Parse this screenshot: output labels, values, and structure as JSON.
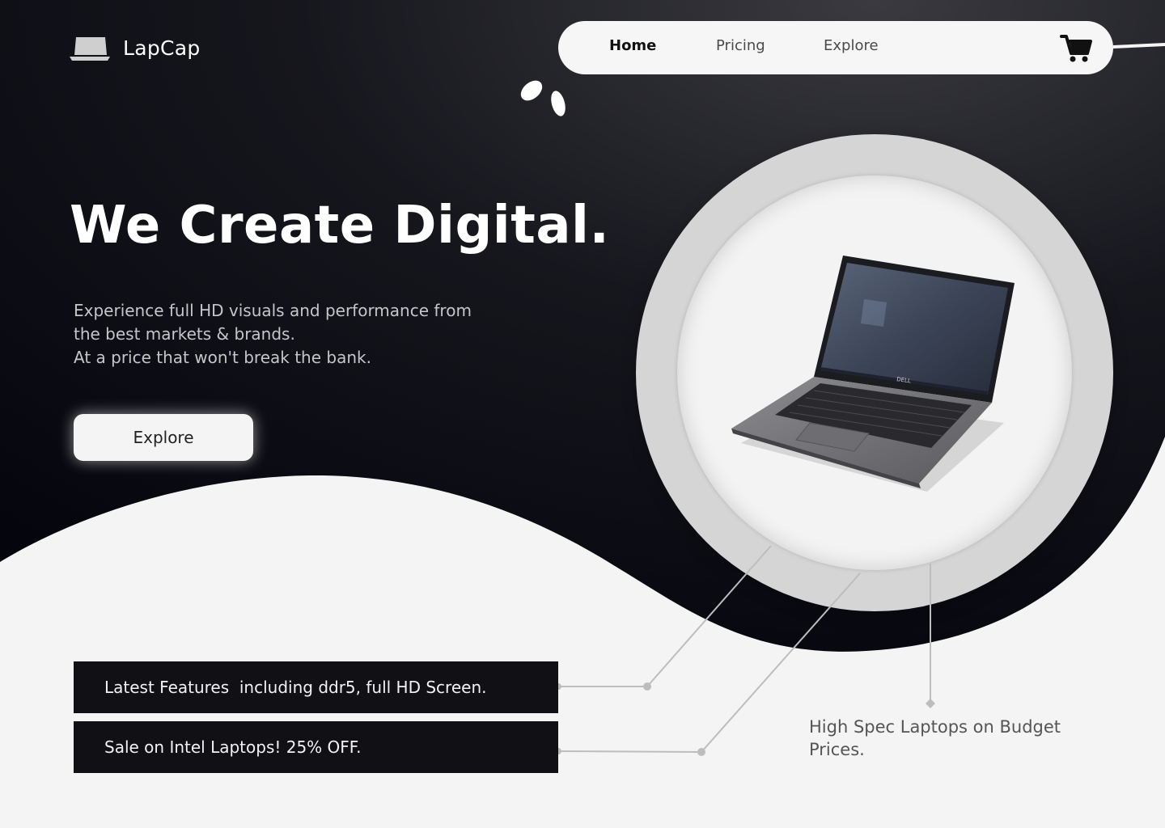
{
  "brand": {
    "name": "LapCap",
    "logo_icon": "laptop-icon"
  },
  "nav": {
    "items": [
      {
        "label": "Home",
        "active": true
      },
      {
        "label": "Pricing",
        "active": false
      },
      {
        "label": "Explore",
        "active": false
      }
    ],
    "cart_icon": "cart-icon"
  },
  "hero": {
    "title": "We Create Digital.",
    "subtitle_lines": [
      "Experience full HD visuals and performance from",
      "the best markets & brands.",
      "At a price that won't break the bank."
    ],
    "cta_label": "Explore"
  },
  "features": [
    "Latest Features  including ddr5, full HD Screen.",
    "Sale on Intel Laptops! 25% OFF."
  ],
  "spec_note": "High Spec Laptops on Budget Prices.",
  "product": {
    "image": "laptop-product-image",
    "brand_mark": "DELL"
  },
  "colors": {
    "dark_bg": "#08080f",
    "light_bg": "#f4f4f4",
    "feature_bg": "#111115",
    "nav_bg": "#f6f6f6"
  }
}
